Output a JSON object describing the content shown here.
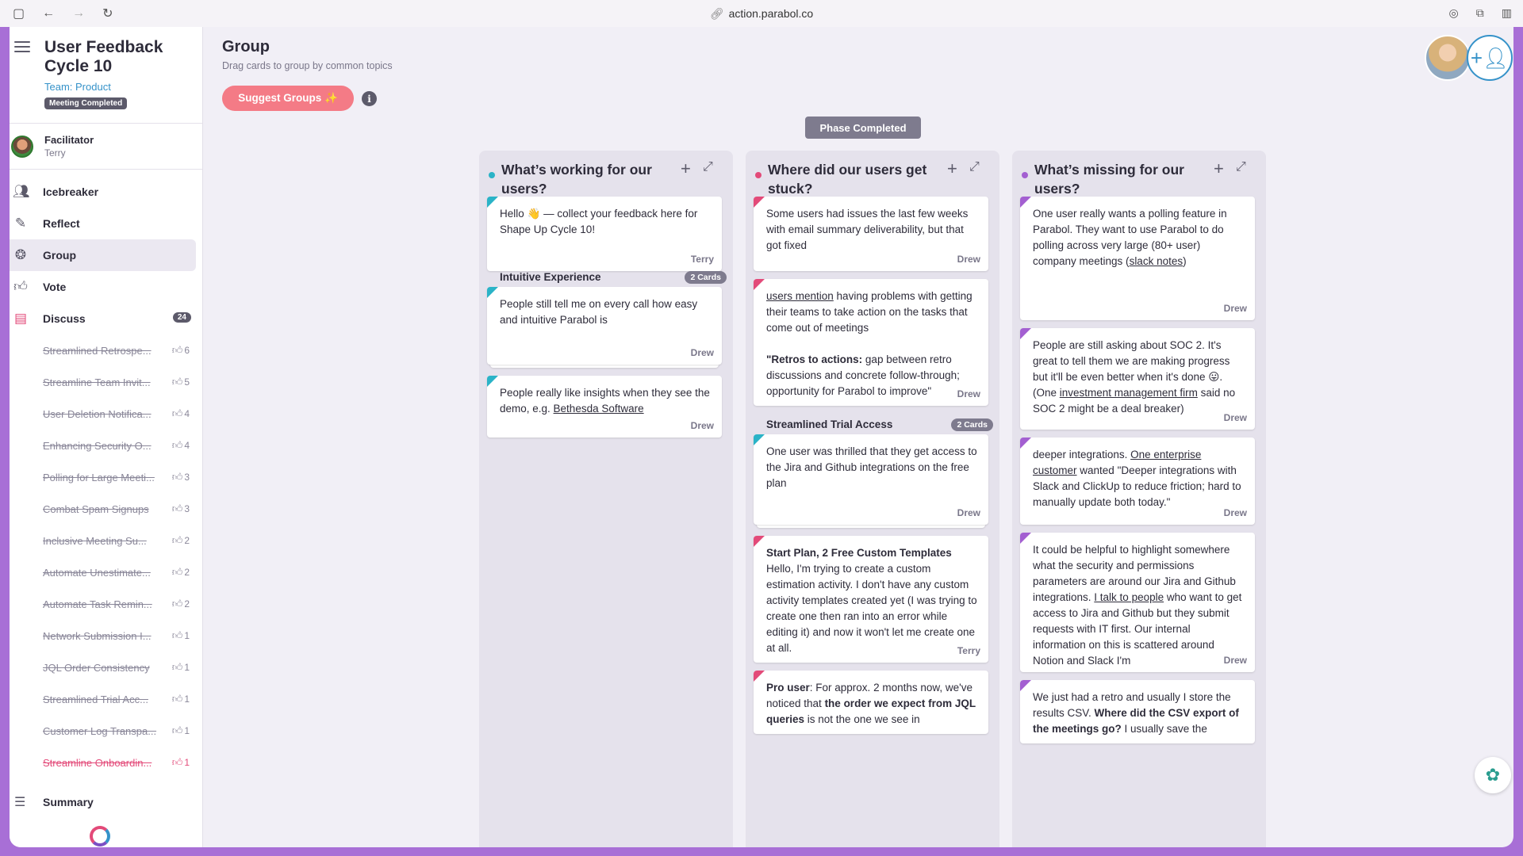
{
  "browser": {
    "url": "action.parabol.co",
    "lock_icon": "link-icon"
  },
  "sidebar": {
    "meeting_title": "User Feedback Cycle 10",
    "team": "Team: Product",
    "status_badge": "Meeting Completed",
    "facilitator_label": "Facilitator",
    "facilitator_name": "Terry",
    "nav": [
      {
        "label": "Icebreaker",
        "icon": "users-icon"
      },
      {
        "label": "Reflect",
        "icon": "pencil-icon"
      },
      {
        "label": "Group",
        "icon": "group-icon"
      },
      {
        "label": "Vote",
        "icon": "thumbs-icon"
      },
      {
        "label": "Discuss",
        "icon": "chat-icon",
        "count": "24"
      }
    ],
    "topics": [
      {
        "label": "Streamlined Retrospe...",
        "votes": "6"
      },
      {
        "label": "Streamline Team Invit...",
        "votes": "5"
      },
      {
        "label": "User Deletion Notifica...",
        "votes": "4"
      },
      {
        "label": "Enhancing Security O...",
        "votes": "4"
      },
      {
        "label": "Polling for Large Meeti...",
        "votes": "3"
      },
      {
        "label": "Combat Spam Signups",
        "votes": "3"
      },
      {
        "label": "Inclusive Meeting Su...",
        "votes": "2"
      },
      {
        "label": "Automate Unestimate...",
        "votes": "2"
      },
      {
        "label": "Automate Task Remin...",
        "votes": "2"
      },
      {
        "label": "Network Submission I...",
        "votes": "1"
      },
      {
        "label": "JQL Order Consistency",
        "votes": "1"
      },
      {
        "label": "Streamlined Trial Acc...",
        "votes": "1"
      },
      {
        "label": "Customer Log Transpa...",
        "votes": "1"
      },
      {
        "label": "Streamline Onboardin...",
        "votes": "1"
      }
    ],
    "summary_label": "Summary"
  },
  "main": {
    "title": "Group",
    "subtitle": "Drag cards to group by common topics",
    "suggest_button": "Suggest Groups ✨",
    "phase_label": "Phase Completed"
  },
  "columns": [
    {
      "title": "What’s working for our users?",
      "color": "#2ab3c7",
      "card1": {
        "text": "Hello 👋 — collect your feedback here for Shape Up Cycle 10!",
        "author": "Terry"
      },
      "group": {
        "title": "Intuitive Experience",
        "count": "2 Cards"
      },
      "card2": {
        "text": "People still tell me on every call how easy and intuitive Parabol is",
        "author": "Drew"
      },
      "card3": {
        "text_a": "People really like insights when they see the demo, e.g. ",
        "link": "Bethesda Software",
        "author": "Drew"
      }
    },
    {
      "title": "Where did our users get stuck?",
      "color": "#e34a79",
      "card1": {
        "text": "Some users had issues the last few weeks with email summary deliverability, but that got fixed",
        "author": "Drew"
      },
      "card2": {
        "link": "users mention",
        "text_a": " having problems with getting their teams to take action on the tasks that come out of meetings",
        "quote_bold": "\"Retros to actions:",
        "quote_rest": " gap between retro discussions and concrete follow-through; opportunity for Parabol to improve\"",
        "author": "Drew"
      },
      "group": {
        "title": "Streamlined Trial Access",
        "count": "2 Cards"
      },
      "card3": {
        "text": "One user was thrilled that they get access to the Jira and Github integrations on the free plan",
        "author": "Drew"
      },
      "card4": {
        "bold": "Start Plan, 2 Free Custom Templates",
        "text": "Hello, I'm trying to create a custom estimation activity. I don't have any custom activity templates created yet (I was trying to create one then ran into an error while editing it) and now it won't let me create one at all.",
        "author": "Terry"
      },
      "card5": {
        "bold1": "Pro user",
        "text1": ": For approx. 2 months now, we've noticed that ",
        "bold2": "the order we expect from JQL queries",
        "text2": " is not the one we see in"
      }
    },
    {
      "title": "What’s missing for our users?",
      "color": "#a35fd1",
      "card1": {
        "text_a": "One user really wants a polling feature in Parabol. They want to use Parabol to do polling across very large (80+ user) company meetings (",
        "link": "slack notes",
        "text_b": ")",
        "author": "Drew"
      },
      "card2": {
        "text_a": "People are still asking about SOC 2. It's great to tell them we are making progress but it'll be even better when it's done 😛. (One ",
        "link": "investment management firm",
        "text_b": " said no SOC 2 might be a deal breaker)",
        "author": "Drew"
      },
      "card3": {
        "text_a": "deeper integrations. ",
        "link": "One enterprise customer",
        "text_b": " wanted \"Deeper integrations with Slack and ClickUp to reduce friction; hard to manually update both today.\"",
        "author": "Drew"
      },
      "card4": {
        "text_a": "It could be helpful to highlight somewhere what the security and permissions parameters are around our Jira and Github integrations. ",
        "link": "I talk to people",
        "text_b": " who want to get access to Jira and Github but they submit requests with IT first. Our internal information on this is scattered around Notion and Slack I'm",
        "author": "Drew"
      },
      "card5": {
        "text_a": "We just had a retro and usually I store the results CSV. ",
        "bold": "Where did the CSV export of the meetings go?",
        "text_b": " I usually save the"
      }
    }
  ]
}
